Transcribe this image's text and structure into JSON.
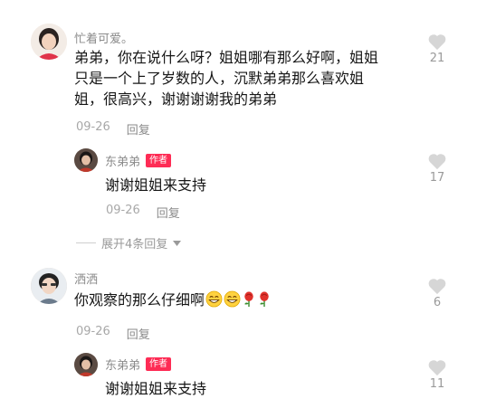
{
  "comments": [
    {
      "username": "忙着可爱。",
      "lines": [
        "弟弟，你在说什么呀？姐姐哪有那么好啊，姐姐",
        "只是一个上了岁数的人，沉默弟弟那么喜欢姐",
        "姐，很高兴，谢谢谢谢我的弟弟"
      ],
      "date": "09-26",
      "reply_label": "回复",
      "likes": "21",
      "replies": [
        {
          "username": "东弟弟",
          "badge": "作者",
          "text": "谢谢姐姐来支持",
          "date": "09-26",
          "reply_label": "回复",
          "likes": "17"
        }
      ],
      "expand_label": "展开4条回复"
    },
    {
      "username": "洒洒",
      "text": "你观察的那么仔细啊",
      "emojis": [
        "grin-emoji",
        "grin-emoji",
        "rose-emoji",
        "rose-emoji"
      ],
      "date": "09-26",
      "reply_label": "回复",
      "likes": "6",
      "replies": [
        {
          "username": "东弟弟",
          "badge": "作者",
          "text": "谢谢姐姐来支持",
          "likes": "11"
        }
      ]
    }
  ],
  "colors": {
    "text": "#161616",
    "meta": "#a8a8a8",
    "author_badge": "#fe2c55",
    "heart": "#d6d6d6"
  }
}
